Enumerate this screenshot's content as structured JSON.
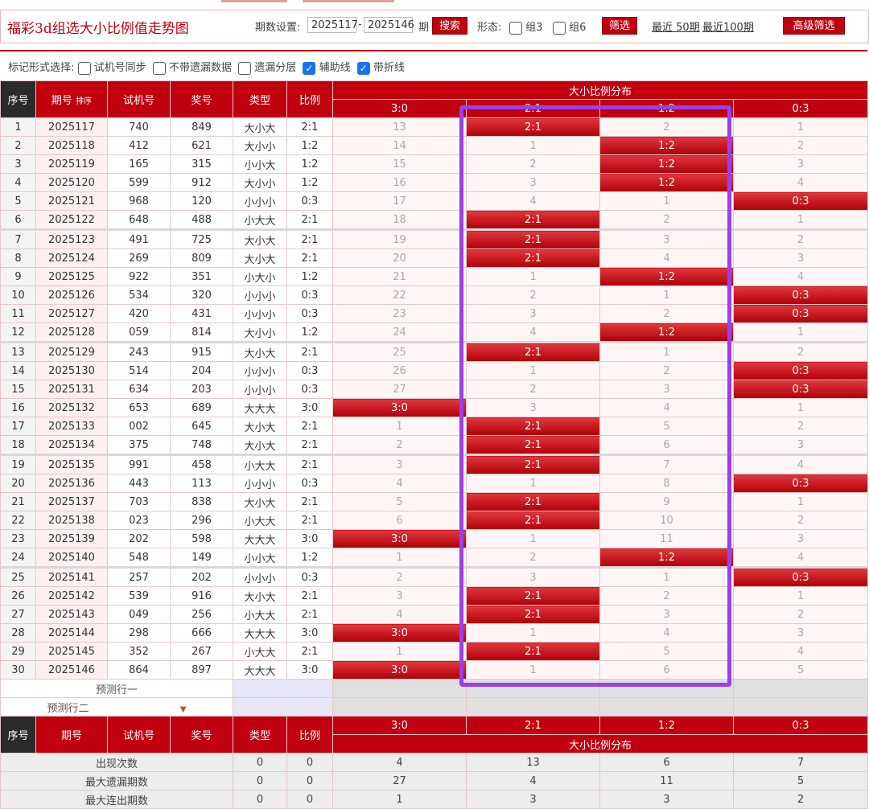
{
  "title": "福彩3d组选大小比例值走势图",
  "controls": {
    "period_label": "期数设置:",
    "start": "2025117",
    "dash": "-",
    "end": "2025146",
    "period_unit": "期",
    "search": "搜索",
    "shape_label": "形态:",
    "group3": "组3",
    "group6": "组6",
    "filter": "筛选",
    "recent50": "最近 50期",
    "recent100": "最近100期",
    "advanced": "高级筛选"
  },
  "marks": {
    "label": "标记形式选择:",
    "options": [
      {
        "label": "试机号同步",
        "checked": false
      },
      {
        "label": "不带遗漏数据",
        "checked": false
      },
      {
        "label": "遗漏分层",
        "checked": false
      },
      {
        "label": "辅助线",
        "checked": true
      },
      {
        "label": "带折线",
        "checked": true
      }
    ]
  },
  "table": {
    "headers": {
      "seq": "序号",
      "period": "期号",
      "sort": "排序",
      "test": "试机号",
      "prize": "奖号",
      "type": "类型",
      "ratio": "比例",
      "dist": "大小比例分布"
    },
    "dist_cols": [
      "3:0",
      "2:1",
      "1:2",
      "0:3"
    ],
    "rows": [
      {
        "seq": "1",
        "period": "2025117",
        "test": "740",
        "prize": "849",
        "type": "大小大",
        "ratio": "2:1",
        "dist": [
          "13",
          "2:1",
          "2",
          "1"
        ],
        "hit": 1
      },
      {
        "seq": "2",
        "period": "2025118",
        "test": "412",
        "prize": "621",
        "type": "大小小",
        "ratio": "1:2",
        "dist": [
          "14",
          "1",
          "1:2",
          "2"
        ],
        "hit": 2
      },
      {
        "seq": "3",
        "period": "2025119",
        "test": "165",
        "prize": "315",
        "type": "小小大",
        "ratio": "1:2",
        "dist": [
          "15",
          "2",
          "1:2",
          "3"
        ],
        "hit": 2
      },
      {
        "seq": "4",
        "period": "2025120",
        "test": "599",
        "prize": "912",
        "type": "大小小",
        "ratio": "1:2",
        "dist": [
          "16",
          "3",
          "1:2",
          "4"
        ],
        "hit": 2
      },
      {
        "seq": "5",
        "period": "2025121",
        "test": "968",
        "prize": "120",
        "type": "小小小",
        "ratio": "0:3",
        "dist": [
          "17",
          "4",
          "1",
          "0:3"
        ],
        "hit": 3
      },
      {
        "seq": "6",
        "period": "2025122",
        "test": "648",
        "prize": "488",
        "type": "小大大",
        "ratio": "2:1",
        "dist": [
          "18",
          "2:1",
          "2",
          "1"
        ],
        "hit": 1
      },
      {
        "seq": "7",
        "period": "2025123",
        "test": "491",
        "prize": "725",
        "type": "大小大",
        "ratio": "2:1",
        "dist": [
          "19",
          "2:1",
          "3",
          "2"
        ],
        "hit": 1
      },
      {
        "seq": "8",
        "period": "2025124",
        "test": "269",
        "prize": "809",
        "type": "大小大",
        "ratio": "2:1",
        "dist": [
          "20",
          "2:1",
          "4",
          "3"
        ],
        "hit": 1
      },
      {
        "seq": "9",
        "period": "2025125",
        "test": "922",
        "prize": "351",
        "type": "小大小",
        "ratio": "1:2",
        "dist": [
          "21",
          "1",
          "1:2",
          "4"
        ],
        "hit": 2
      },
      {
        "seq": "10",
        "period": "2025126",
        "test": "534",
        "prize": "320",
        "type": "小小小",
        "ratio": "0:3",
        "dist": [
          "22",
          "2",
          "1",
          "0:3"
        ],
        "hit": 3
      },
      {
        "seq": "11",
        "period": "2025127",
        "test": "420",
        "prize": "431",
        "type": "小小小",
        "ratio": "0:3",
        "dist": [
          "23",
          "3",
          "2",
          "0:3"
        ],
        "hit": 3
      },
      {
        "seq": "12",
        "period": "2025128",
        "test": "059",
        "prize": "814",
        "type": "大小小",
        "ratio": "1:2",
        "dist": [
          "24",
          "4",
          "1:2",
          "1"
        ],
        "hit": 2
      },
      {
        "seq": "13",
        "period": "2025129",
        "test": "243",
        "prize": "915",
        "type": "大小大",
        "ratio": "2:1",
        "dist": [
          "25",
          "2:1",
          "1",
          "2"
        ],
        "hit": 1
      },
      {
        "seq": "14",
        "period": "2025130",
        "test": "514",
        "prize": "204",
        "type": "小小小",
        "ratio": "0:3",
        "dist": [
          "26",
          "1",
          "2",
          "0:3"
        ],
        "hit": 3
      },
      {
        "seq": "15",
        "period": "2025131",
        "test": "634",
        "prize": "203",
        "type": "小小小",
        "ratio": "0:3",
        "dist": [
          "27",
          "2",
          "3",
          "0:3"
        ],
        "hit": 3
      },
      {
        "seq": "16",
        "period": "2025132",
        "test": "653",
        "prize": "689",
        "type": "大大大",
        "ratio": "3:0",
        "dist": [
          "3:0",
          "3",
          "4",
          "1"
        ],
        "hit": 0
      },
      {
        "seq": "17",
        "period": "2025133",
        "test": "002",
        "prize": "645",
        "type": "大小大",
        "ratio": "2:1",
        "dist": [
          "1",
          "2:1",
          "5",
          "2"
        ],
        "hit": 1
      },
      {
        "seq": "18",
        "period": "2025134",
        "test": "375",
        "prize": "748",
        "type": "大小大",
        "ratio": "2:1",
        "dist": [
          "2",
          "2:1",
          "6",
          "3"
        ],
        "hit": 1
      },
      {
        "seq": "19",
        "period": "2025135",
        "test": "991",
        "prize": "458",
        "type": "小大大",
        "ratio": "2:1",
        "dist": [
          "3",
          "2:1",
          "7",
          "4"
        ],
        "hit": 1
      },
      {
        "seq": "20",
        "period": "2025136",
        "test": "443",
        "prize": "113",
        "type": "小小小",
        "ratio": "0:3",
        "dist": [
          "4",
          "1",
          "8",
          "0:3"
        ],
        "hit": 3
      },
      {
        "seq": "21",
        "period": "2025137",
        "test": "703",
        "prize": "838",
        "type": "大小大",
        "ratio": "2:1",
        "dist": [
          "5",
          "2:1",
          "9",
          "1"
        ],
        "hit": 1
      },
      {
        "seq": "22",
        "period": "2025138",
        "test": "023",
        "prize": "296",
        "type": "小大大",
        "ratio": "2:1",
        "dist": [
          "6",
          "2:1",
          "10",
          "2"
        ],
        "hit": 1
      },
      {
        "seq": "23",
        "period": "2025139",
        "test": "202",
        "prize": "598",
        "type": "大大大",
        "ratio": "3:0",
        "dist": [
          "3:0",
          "1",
          "11",
          "3"
        ],
        "hit": 0
      },
      {
        "seq": "24",
        "period": "2025140",
        "test": "548",
        "prize": "149",
        "type": "小小大",
        "ratio": "1:2",
        "dist": [
          "1",
          "2",
          "1:2",
          "4"
        ],
        "hit": 2
      },
      {
        "seq": "25",
        "period": "2025141",
        "test": "257",
        "prize": "202",
        "type": "小小小",
        "ratio": "0:3",
        "dist": [
          "2",
          "3",
          "1",
          "0:3"
        ],
        "hit": 3
      },
      {
        "seq": "26",
        "period": "2025142",
        "test": "539",
        "prize": "916",
        "type": "大小大",
        "ratio": "2:1",
        "dist": [
          "3",
          "2:1",
          "2",
          "1"
        ],
        "hit": 1
      },
      {
        "seq": "27",
        "period": "2025143",
        "test": "049",
        "prize": "256",
        "type": "小大大",
        "ratio": "2:1",
        "dist": [
          "4",
          "2:1",
          "3",
          "2"
        ],
        "hit": 1
      },
      {
        "seq": "28",
        "period": "2025144",
        "test": "298",
        "prize": "666",
        "type": "大大大",
        "ratio": "3:0",
        "dist": [
          "3:0",
          "1",
          "4",
          "3"
        ],
        "hit": 0
      },
      {
        "seq": "29",
        "period": "2025145",
        "test": "352",
        "prize": "267",
        "type": "小大大",
        "ratio": "2:1",
        "dist": [
          "1",
          "2:1",
          "5",
          "4"
        ],
        "hit": 1
      },
      {
        "seq": "30",
        "period": "2025146",
        "test": "864",
        "prize": "897",
        "type": "大大大",
        "ratio": "3:0",
        "dist": [
          "3:0",
          "1",
          "6",
          "5"
        ],
        "hit": 0
      }
    ],
    "predict": [
      "预测行一",
      "预测行二"
    ],
    "stats": [
      {
        "label": "出现次数",
        "type": "0",
        "ratio": "0",
        "vals": [
          "4",
          "13",
          "6",
          "7"
        ]
      },
      {
        "label": "最大遗漏期数",
        "type": "0",
        "ratio": "0",
        "vals": [
          "27",
          "4",
          "11",
          "5"
        ]
      },
      {
        "label": "最大连出期数",
        "type": "0",
        "ratio": "0",
        "vals": [
          "1",
          "3",
          "3",
          "2"
        ]
      }
    ]
  },
  "colors": {
    "accent": "#c0000f",
    "highlight": "#9a3ff0"
  }
}
